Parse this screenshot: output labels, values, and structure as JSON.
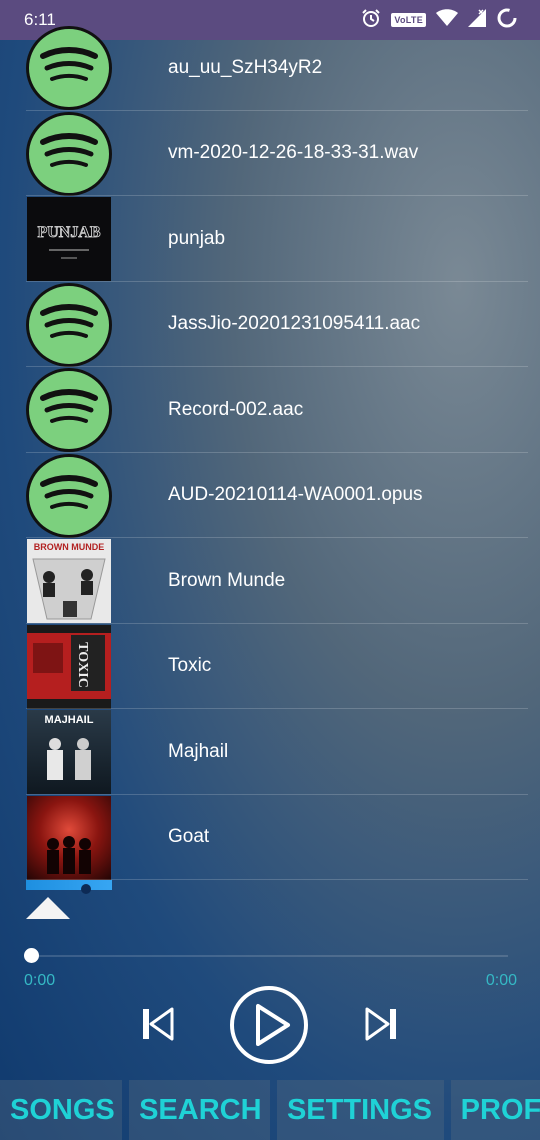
{
  "status_bar": {
    "time": "6:11",
    "volte_label": "VoLTE",
    "icons": [
      "alarm-icon",
      "wifi-icon",
      "signal-icon",
      "battery-icon"
    ]
  },
  "songs": [
    {
      "title": "au_uu_SzH34yR2",
      "art": "spotify-icon"
    },
    {
      "title": "vm-2020-12-26-18-33-31.wav",
      "art": "spotify-icon"
    },
    {
      "title": "punjab",
      "art": "album-cover-punjab"
    },
    {
      "title": "JassJio-20201231095411.aac",
      "art": "spotify-icon"
    },
    {
      "title": "Record-002.aac",
      "art": "spotify-icon"
    },
    {
      "title": "AUD-20210114-WA0001.opus",
      "art": "spotify-icon"
    },
    {
      "title": "Brown Munde",
      "art": "album-cover-brown-munde"
    },
    {
      "title": "Toxic",
      "art": "album-cover-toxic"
    },
    {
      "title": "Majhail",
      "art": "album-cover-majhail"
    },
    {
      "title": "Goat",
      "art": "album-cover-goat"
    }
  ],
  "cover_text": {
    "punjab": "PUNJAB",
    "brown_munde": "BROWN MUNDE",
    "toxic": "TOXIC",
    "majhail": "MAJHAIL"
  },
  "player": {
    "elapsed": "0:00",
    "duration": "0:00",
    "progress": 0
  },
  "tabs": [
    {
      "label": "SONGS"
    },
    {
      "label": "SEARCH"
    },
    {
      "label": "SETTINGS"
    },
    {
      "label": "PROF"
    }
  ],
  "colors": {
    "status_bar": "#5b4b80",
    "accent": "#1fd2d6",
    "spotify_green": "#7cd07e"
  }
}
